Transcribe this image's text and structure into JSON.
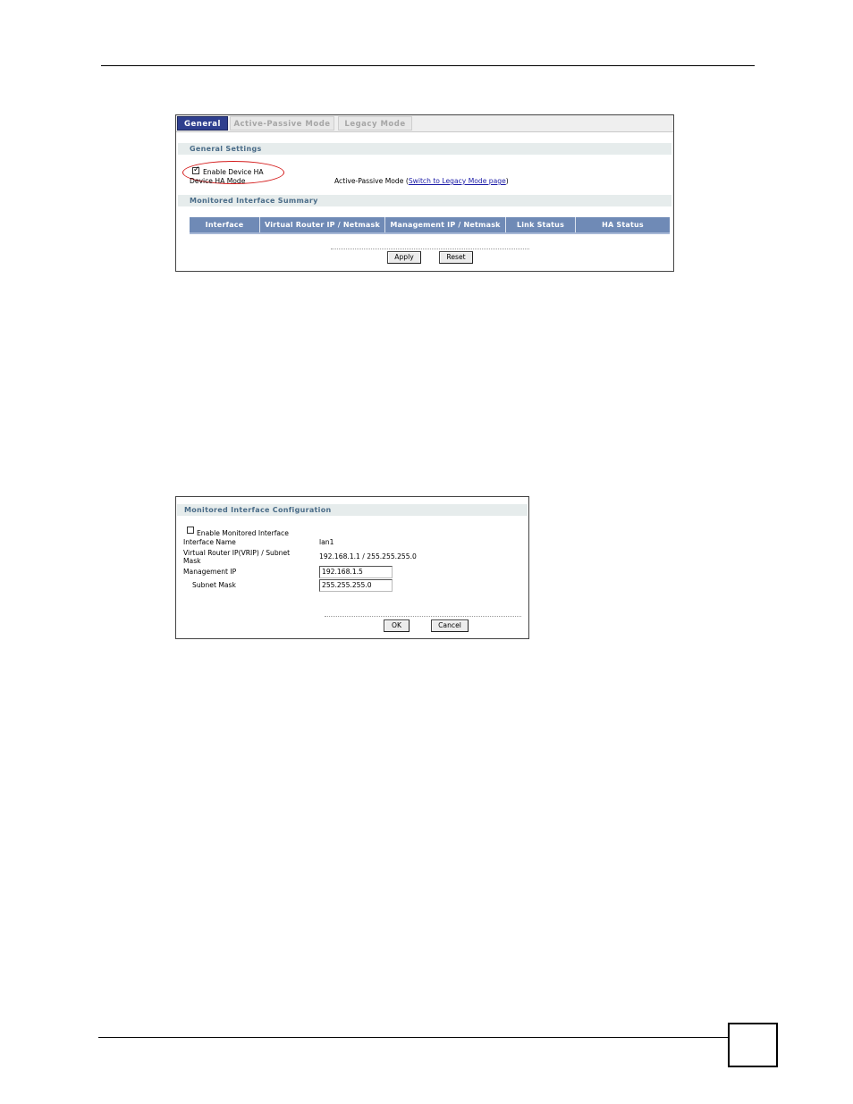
{
  "tabs": [
    {
      "label": "General",
      "active": true
    },
    {
      "label": "Active-Passive Mode",
      "active": false
    },
    {
      "label": "Legacy Mode",
      "active": false
    }
  ],
  "general_settings": {
    "section_title": "General Settings",
    "enable_device_ha_label": "Enable Device HA",
    "enable_device_ha_checked": true,
    "device_ha_mode_label": "Device HA Mode",
    "device_ha_mode_value": "Active-Passive Mode",
    "paren_open": "(",
    "switch_link": "Switch to Legacy Mode page",
    "paren_close": ")"
  },
  "monitored_summary": {
    "section_title": "Monitored Interface Summary",
    "columns": [
      "Interface",
      "Virtual Router IP / Netmask",
      "Management IP / Netmask",
      "Link Status",
      "HA Status"
    ]
  },
  "panel1_buttons": {
    "apply": "Apply",
    "reset": "Reset"
  },
  "monitored_config": {
    "section_title": "Monitored Interface Configuration",
    "enable_label": "Enable Monitored Interface",
    "enable_checked": false,
    "interface_name_label": "Interface Name",
    "interface_name_value": "lan1",
    "vrip_label_line1": "Virtual Router IP(VRIP) / Subnet",
    "vrip_label_line2": "Mask",
    "vrip_value": "192.168.1.1 / 255.255.255.0",
    "mgmt_ip_label": "Management IP",
    "mgmt_ip_value": "192.168.1.5",
    "subnet_mask_label": "Subnet Mask",
    "subnet_mask_value": "255.255.255.0"
  },
  "panel2_buttons": {
    "ok": "OK",
    "cancel": "Cancel"
  },
  "colors": {
    "active_tab": "#2f3f8e",
    "table_header": "#6f8ab6",
    "section_text": "#4a6c88",
    "highlight_ellipse": "#d41a1a"
  }
}
